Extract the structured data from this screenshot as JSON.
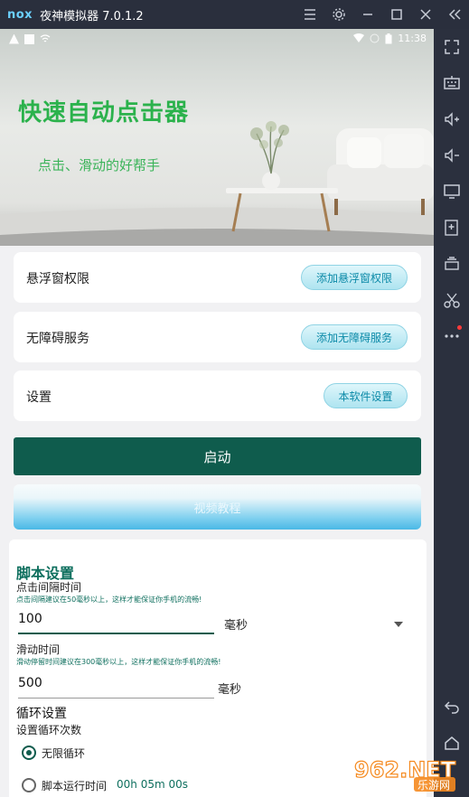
{
  "window": {
    "brand": "nox",
    "title": "夜神模拟器 7.0.1.2"
  },
  "status": {
    "time": "11:38"
  },
  "banner": {
    "title": "快速自动点击器",
    "subtitle": "点击、滑动的好帮手"
  },
  "rows": [
    {
      "label": "悬浮窗权限",
      "button": "添加悬浮窗权限"
    },
    {
      "label": "无障碍服务",
      "button": "添加无障碍服务"
    },
    {
      "label": "设置",
      "button": "本软件设置"
    }
  ],
  "start_label": "启动",
  "video_label": "视频教程",
  "script": {
    "title": "脚本设置",
    "click_interval_label": "点击间隔时间",
    "click_interval_hint": "点击间隔建议在50毫秒以上，这样才能保证你手机的流畅!",
    "click_interval_value": "100",
    "click_interval_unit": "毫秒",
    "slide_label": "滑动时间",
    "slide_hint": "滑动停留时间建议在300毫秒以上，这样才能保证你手机的流畅!",
    "slide_value": "500",
    "slide_unit": "毫秒",
    "loop_title": "循环设置",
    "loop_count_label": "设置循环次数",
    "loop_infinite": "无限循环",
    "loop_runtime": "脚本运行时间",
    "loop_runtime_value": "00h 05m 00s"
  },
  "watermark": {
    "text": "962.NET",
    "sub": "乐游网"
  },
  "colors": {
    "accent": "#0f5c4d",
    "banner_green": "#2bb24c",
    "pill_text": "#0c8aa8"
  }
}
